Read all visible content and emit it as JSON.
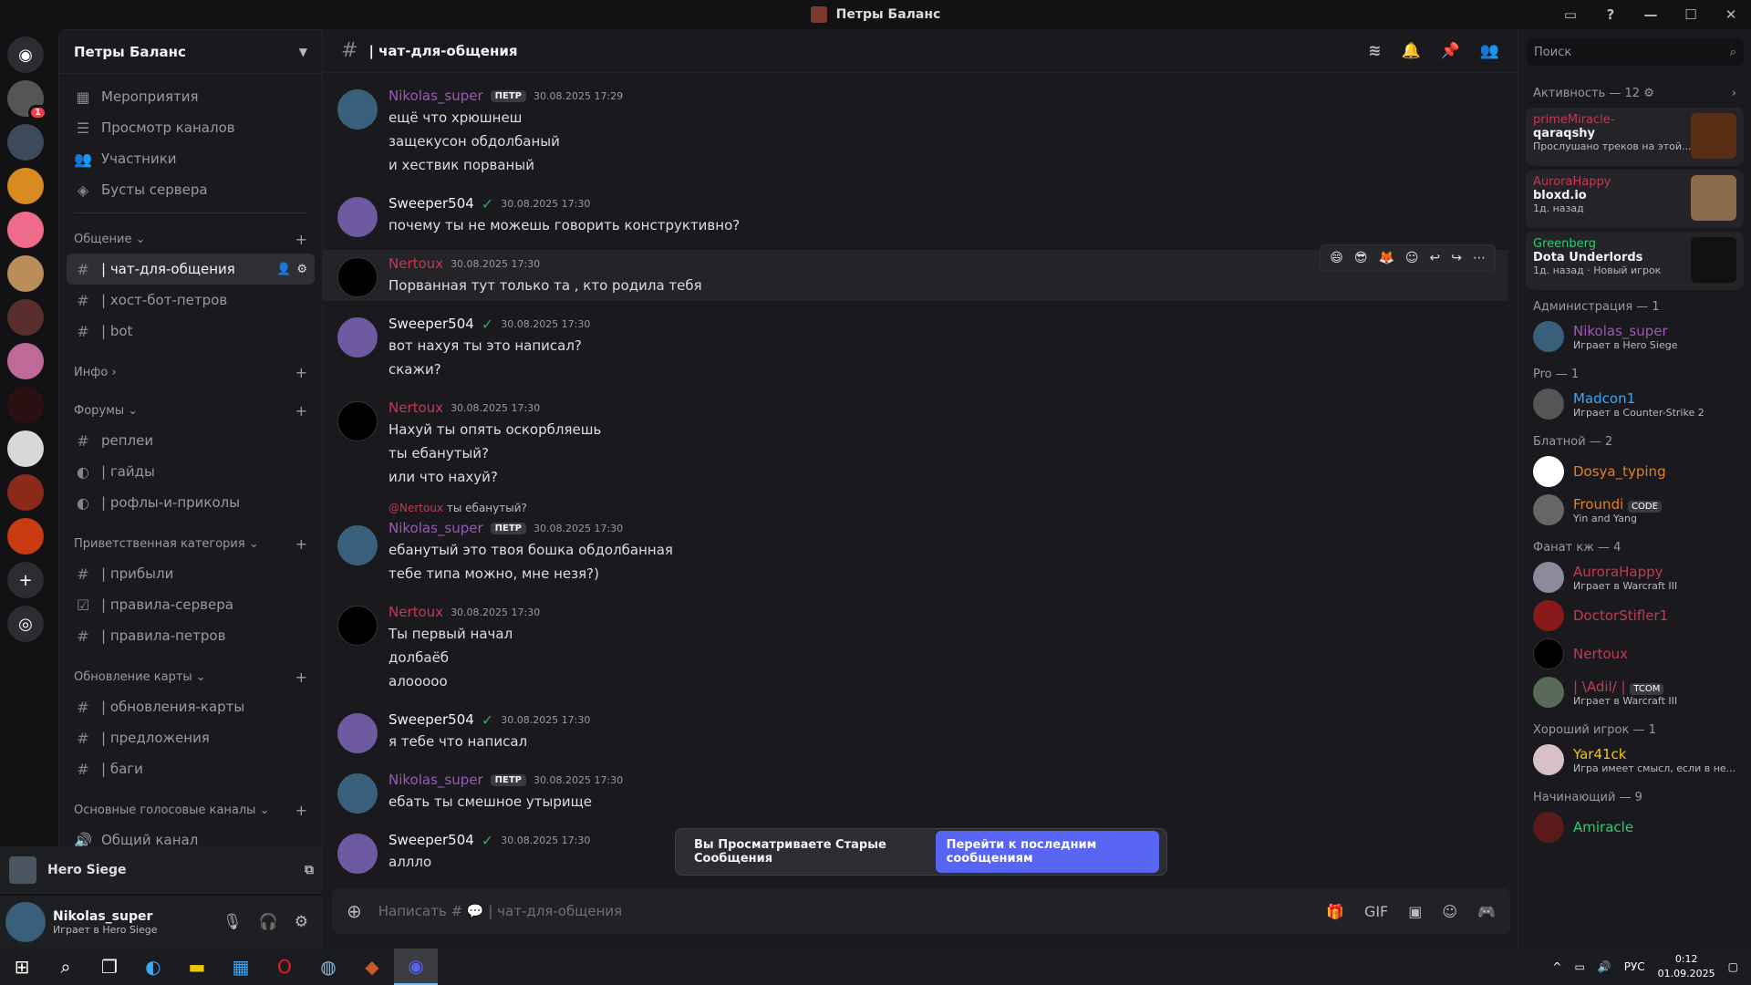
{
  "window": {
    "title": "Петры Баланс",
    "controls": [
      "▭",
      "?",
      "—",
      "☐",
      "✕"
    ]
  },
  "colors": {
    "nikolas": "#9b59b6",
    "sweeper": "#f2f3f5",
    "nertoux": "#c23a55",
    "accent": "#5865f2"
  },
  "guilds": [
    {
      "icon": "discord-logo",
      "badge": ""
    },
    {
      "icon": "server-1",
      "badge": "1"
    },
    {
      "icon": "server-2",
      "badge": ""
    },
    {
      "icon": "server-3",
      "badge": ""
    },
    {
      "icon": "server-4",
      "badge": ""
    },
    {
      "icon": "server-5",
      "badge": ""
    },
    {
      "icon": "server-6",
      "badge": ""
    },
    {
      "icon": "server-7",
      "badge": ""
    },
    {
      "icon": "server-8",
      "badge": ""
    },
    {
      "icon": "server-9",
      "badge": ""
    },
    {
      "icon": "server-10",
      "badge": ""
    },
    {
      "icon": "server-11",
      "badge": ""
    },
    {
      "icon": "add-server",
      "badge": ""
    },
    {
      "icon": "discover",
      "badge": ""
    }
  ],
  "sidebar": {
    "server_name": "Петры Баланс",
    "top": [
      "Мероприятия",
      "Просмотр каналов",
      "Участники",
      "Бусты сервера"
    ],
    "cat1": "Общение",
    "ch1": "| чат-для-общения",
    "ch2": "| хост-бот-петров",
    "ch3": "| bot",
    "cat2": "Инфо",
    "cat3": "Форумы",
    "ch4": "реплеи",
    "ch5": "| гайды",
    "ch6": "| рофлы-и-приколы",
    "cat4": "Приветственная категория",
    "ch7": "| прибыли",
    "ch8": "| правила-сервера",
    "ch9": "| правила-петров",
    "cat5": "Обновление карты",
    "ch10": "| обновления-карты",
    "ch11": "| предложения",
    "ch12": "| баги",
    "cat6": "Основные голосовые каналы",
    "ch13": "Общий канал"
  },
  "voice": {
    "game": "Hero Siege"
  },
  "user": {
    "name": "Nikolas_super",
    "status": "Играет в Hero Siege"
  },
  "chat": {
    "channel": "| чат-для-общения",
    "tags": {
      "nikolas": "ПЕТР",
      "sweeper": "✓"
    },
    "messages": [
      {
        "author": "Nikolas_super",
        "time": "30.08.2025 17:29",
        "lines": [
          "ещё что хрюшнеш",
          "защекусон обдолбаный",
          "и хествик порваный"
        ]
      },
      {
        "author": "Sweeper504",
        "time": "30.08.2025 17:30",
        "lines": [
          "почему ты не можешь говорить конструктивно?"
        ]
      },
      {
        "author": "Nertoux",
        "time": "30.08.2025 17:30",
        "lines": [
          "Порванная тут только та , кто родила тебя"
        ]
      },
      {
        "author": "Sweeper504",
        "time": "30.08.2025 17:30",
        "lines": [
          "вот нахуя ты это написал?",
          "скажи?"
        ]
      },
      {
        "author": "Nertoux",
        "time": "30.08.2025 17:30",
        "lines": [
          "Нахуй ты опять оскорбляешь",
          "ты ебанутый?",
          "или что нахуй?"
        ]
      },
      {
        "author": "Nikolas_super",
        "time": "30.08.2025 17:30",
        "reply_name": "@Nertoux",
        "reply_text": "ты ебанутый?",
        "lines": [
          "ебанутый это твоя бошка обдолбанная",
          "тебе типа можно, мне незя?)"
        ]
      },
      {
        "author": "Nertoux",
        "time": "30.08.2025 17:30",
        "lines": [
          "Ты первый начал",
          "долбаёб",
          "алооооо"
        ]
      },
      {
        "author": "Sweeper504",
        "time": "30.08.2025 17:30",
        "lines": [
          "я тебе что написал"
        ]
      },
      {
        "author": "Nikolas_super",
        "time": "30.08.2025 17:30",
        "lines": [
          "ебать ты смешное утырище"
        ]
      },
      {
        "author": "Sweeper504",
        "time": "30.08.2025 17:30",
        "lines": [
          "аллло"
        ]
      }
    ],
    "jump_text": "Вы Просматриваете Старые Сообщения",
    "jump_button": "Перейти к последним сообщениям",
    "composer_placeholder": "Написать # 💬 | чат-для-общения"
  },
  "members": {
    "search_placeholder": "Поиск",
    "activity_header": "Активность — 12",
    "activities": [
      {
        "name": "primeMiracle-",
        "game": "qaraqshy",
        "detail": "Прослушано треков на этой..."
      },
      {
        "name": "AuroraHappy",
        "game": "bloxd.io",
        "detail": "1д. назад"
      },
      {
        "name": "Greenberg",
        "game": "Dota Underlords",
        "detail": "1д. назад · Новый игрок"
      }
    ],
    "g1": "Администрация — 1",
    "g2": "Pro — 1",
    "g3": "Блатной — 2",
    "g4": "Фанат кж — 4",
    "g5": "Хороший игрок — 1",
    "g6": "Начинающий — 9",
    "list": [
      {
        "name": "Nikolas_super",
        "status": "Играет в Hero Siege",
        "color": "#9b59b6"
      },
      {
        "name": "Madcon1",
        "status": "Играет в Counter-Strike 2",
        "color": "#3fa7f5"
      },
      {
        "name": "Dosya_typing",
        "status": "",
        "color": "#e67e22"
      },
      {
        "name": "Froundi",
        "status": "Yin and Yang",
        "color": "#e67e22"
      },
      {
        "name": "AuroraHappy",
        "status": "Играет в Warcraft III",
        "color": "#c23a55"
      },
      {
        "name": "DoctorStifler1",
        "status": "",
        "color": "#c23a55"
      },
      {
        "name": "Nertoux",
        "status": "",
        "color": "#c23a55"
      },
      {
        "name": "| \\Adil/ |",
        "status": "Играет в Warcraft III",
        "color": "#c23a55"
      },
      {
        "name": "Yar41ck",
        "status": "Игра имеет смысл, если в не...",
        "color": "#f1c40f"
      },
      {
        "name": "Amiracle",
        "status": "",
        "color": "#2ecc71"
      }
    ],
    "froundi_tag": "CODE",
    "adil_tag": "TCOM"
  },
  "taskbar": {
    "lang": "РУС",
    "time": "0:12",
    "date": "01.09.2025"
  }
}
